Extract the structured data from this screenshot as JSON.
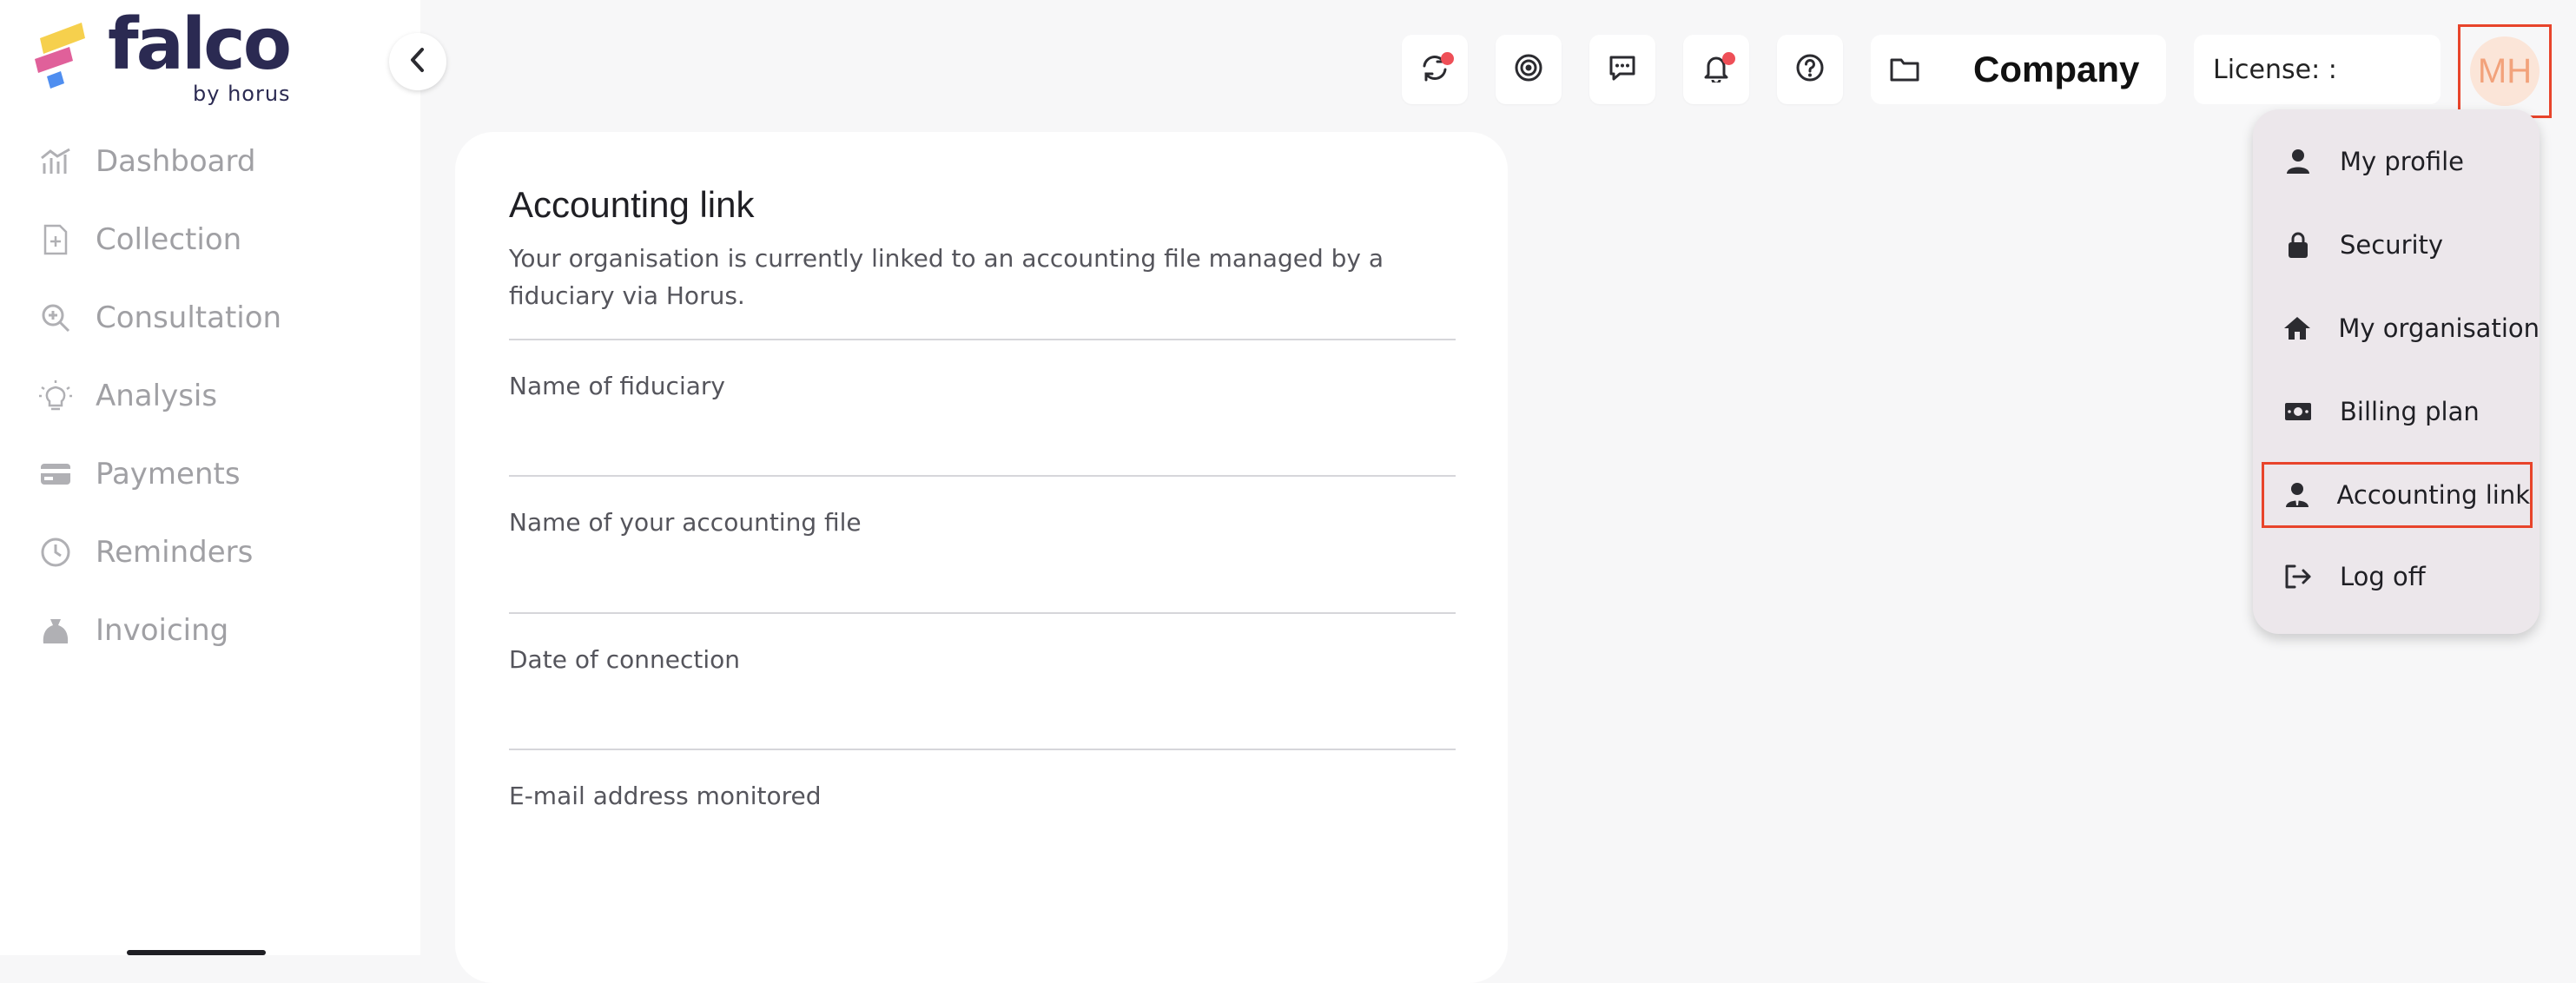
{
  "brand": {
    "name": "falco",
    "sub": "by horus"
  },
  "sidebar": {
    "items": [
      {
        "label": "Dashboard",
        "icon": "chart-icon"
      },
      {
        "label": "Collection",
        "icon": "file-plus-icon"
      },
      {
        "label": "Consultation",
        "icon": "search-icon"
      },
      {
        "label": "Analysis",
        "icon": "lightbulb-icon"
      },
      {
        "label": "Payments",
        "icon": "card-icon"
      },
      {
        "label": "Reminders",
        "icon": "clock-icon"
      },
      {
        "label": "Invoicing",
        "icon": "bag-icon"
      }
    ]
  },
  "topbar": {
    "company": "Company",
    "license": "License: :",
    "avatar_initials": "MH"
  },
  "card": {
    "title": "Accounting link",
    "description": "Your organisation is currently linked to an accounting file managed by a fiduciary via Horus.",
    "fields": [
      {
        "label": "Name of fiduciary",
        "value": ""
      },
      {
        "label": "Name of your accounting file",
        "value": ""
      },
      {
        "label": "Date of connection",
        "value": ""
      },
      {
        "label": "E-mail address monitored",
        "value": ""
      }
    ]
  },
  "menu": {
    "items": [
      {
        "label": "My profile",
        "icon": "person-icon"
      },
      {
        "label": "Security",
        "icon": "lock-icon"
      },
      {
        "label": "My organisation",
        "icon": "home-icon"
      },
      {
        "label": "Billing plan",
        "icon": "money-icon"
      },
      {
        "label": "Accounting link",
        "icon": "accountant-icon"
      },
      {
        "label": "Log off",
        "icon": "logout-icon"
      }
    ]
  },
  "colors": {
    "accent": "#e8442b",
    "notification": "#ee4f57",
    "brand_dark": "#2b2a52",
    "nav_text": "#a0a0a4"
  }
}
